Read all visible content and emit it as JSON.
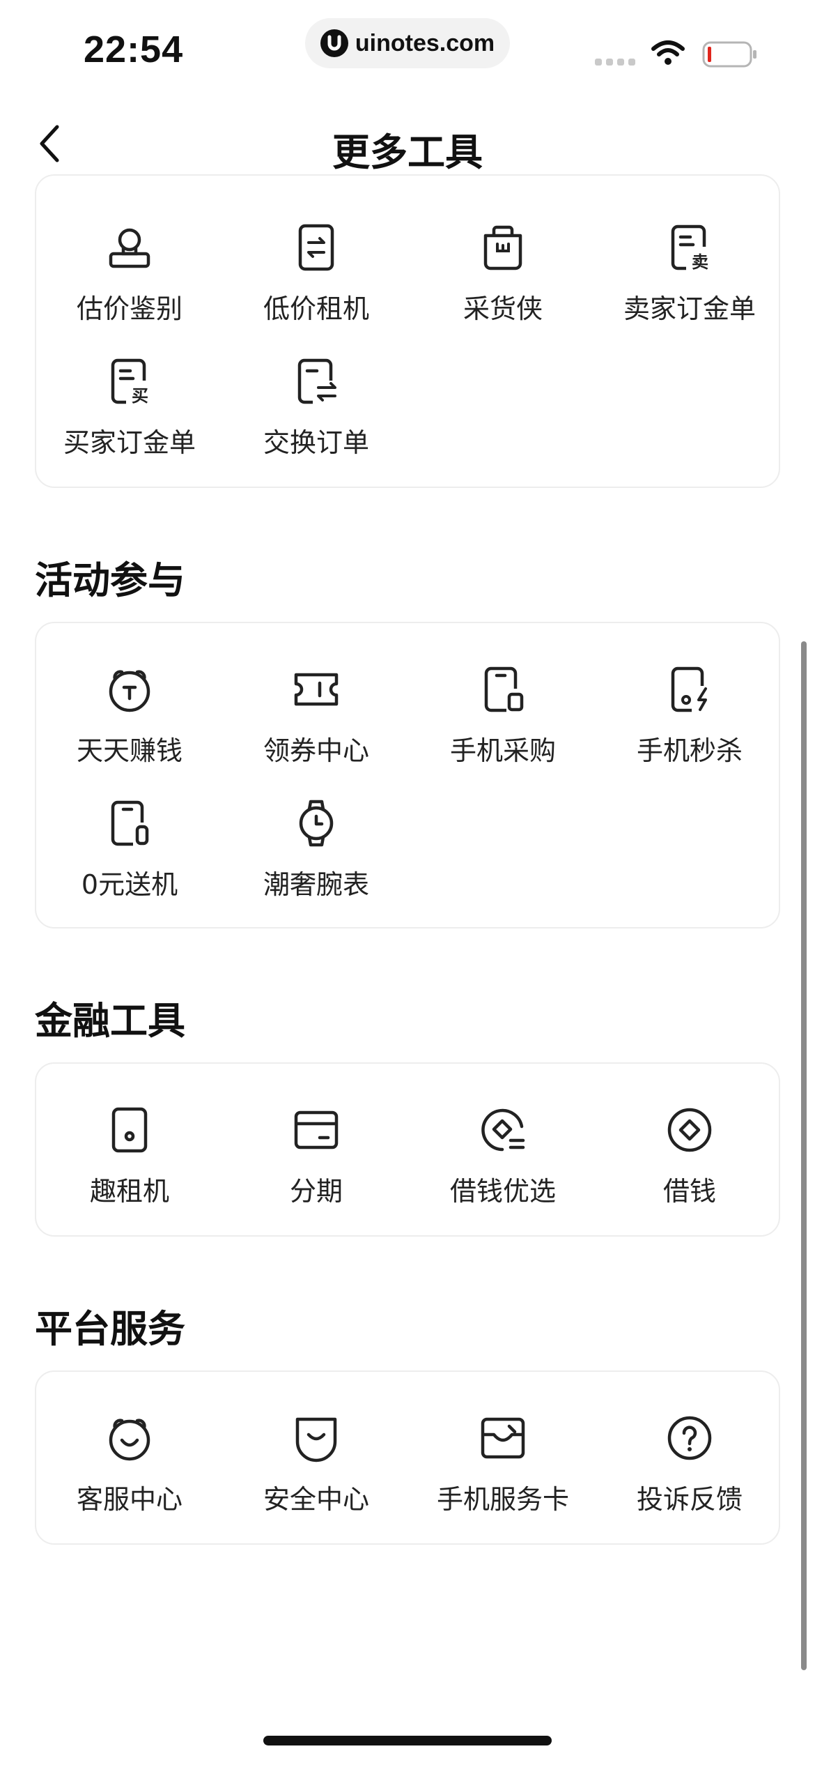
{
  "status": {
    "time": "22:54",
    "url": "uinotes.com"
  },
  "nav": {
    "title": "更多工具"
  },
  "sections": {
    "tools": {
      "items": [
        "估价鉴别",
        "低价租机",
        "采货侠",
        "卖家订金单",
        "买家订金单",
        "交换订单"
      ]
    },
    "activities": {
      "title": "活动参与",
      "items": [
        "天天赚钱",
        "领券中心",
        "手机采购",
        "手机秒杀",
        "0元送机",
        "潮奢腕表"
      ]
    },
    "finance": {
      "title": "金融工具",
      "items": [
        "趣租机",
        "分期",
        "借钱优选",
        "借钱"
      ]
    },
    "services": {
      "title": "平台服务",
      "items": [
        "客服中心",
        "安全中心",
        "手机服务卡",
        "投诉反馈"
      ]
    }
  },
  "icon_badges": {
    "sell": "卖",
    "buy": "买"
  }
}
